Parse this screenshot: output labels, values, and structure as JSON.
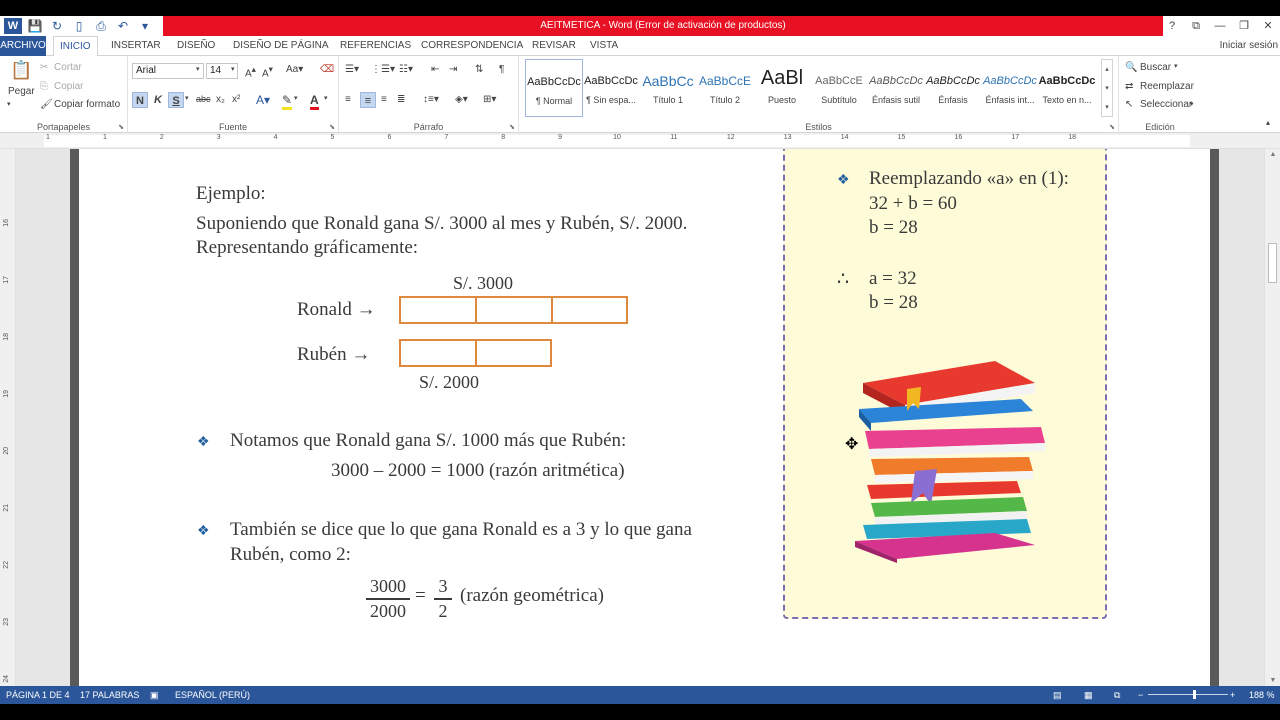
{
  "window": {
    "title": "AEITMETICA -  Word (Error de activación de productos)",
    "controls": [
      "?",
      "⧉",
      "—",
      "❐",
      "✕"
    ]
  },
  "tabs": {
    "file": "ARCHIVO",
    "items": [
      "INICIO",
      "INSERTAR",
      "DISEÑO",
      "DISEÑO DE PÁGINA",
      "REFERENCIAS",
      "CORRESPONDENCIA",
      "REVISAR",
      "VISTA"
    ],
    "signin": "Iniciar sesión"
  },
  "ribbon": {
    "clipboard": {
      "paste": "Pegar",
      "cut": "Cortar",
      "copy": "Copiar",
      "format_painter": "Copiar formato",
      "label": "Portapapeles"
    },
    "font": {
      "name": "Arial",
      "size": "14",
      "label": "Fuente"
    },
    "paragraph": {
      "label": "Párrafo"
    },
    "styles": {
      "label": "Estilos",
      "items": [
        {
          "preview": "AaBbCcDc",
          "name": "¶ Normal"
        },
        {
          "preview": "AaBbCcDc",
          "name": "¶ Sin espa..."
        },
        {
          "preview": "AaBbCc",
          "name": "Título 1"
        },
        {
          "preview": "AaBbCcE",
          "name": "Título 2"
        },
        {
          "preview": "AaBl",
          "name": "Puesto"
        },
        {
          "preview": "AaBbCcE",
          "name": "Subtítulo"
        },
        {
          "preview": "AaBbCcDc",
          "name": "Énfasis sutil"
        },
        {
          "preview": "AaBbCcDc",
          "name": "Énfasis"
        },
        {
          "preview": "AaBbCcDc",
          "name": "Énfasis int..."
        },
        {
          "preview": "AaBbCcDc",
          "name": "Texto en n..."
        }
      ]
    },
    "editing": {
      "find": "Buscar",
      "replace": "Reemplazar",
      "select": "Seleccionar",
      "label": "Edición"
    }
  },
  "ruler": {
    "numbers": [
      "1",
      "1",
      "2",
      "3",
      "4",
      "5",
      "6",
      "7",
      "8",
      "9",
      "10",
      "11",
      "12",
      "13",
      "14",
      "15",
      "16",
      "17",
      "18"
    ],
    "vertical_numbers": [
      "16",
      "17",
      "18",
      "19",
      "20",
      "21",
      "22",
      "23",
      "24"
    ]
  },
  "document": {
    "example_heading": "Ejemplo:",
    "example_line1": "Suponiendo que Ronald gana S/. 3000 al mes y Rubén, S/. 2000.",
    "example_line2": "Representando gráficamente:",
    "diagram": {
      "top_amount": "S/. 3000",
      "ronald_label": "Ronald →",
      "ruben_label": "Rubén →",
      "bottom_amount": "S/. 2000",
      "ronald_segments": 3,
      "ruben_segments": 2
    },
    "bullet1": "Notamos que Ronald gana S/. 1000 más que Rubén:",
    "bullet1_formula": "3000 – 2000 = 1000 (razón aritmética)",
    "bullet2_line1": "También se dice que lo que gana Ronald es a 3 y lo que gana",
    "bullet2_line2": "Rubén, como 2:",
    "fraction": {
      "num1": "3000",
      "den1": "2000",
      "eq": "=",
      "num2": "3",
      "den2": "2",
      "label": "(razón geométrica)"
    },
    "sidebox": {
      "bullet": "Reemplazando «a» en (1):",
      "line1": "32 + b = 60",
      "line2": "b = 28",
      "therefore": "∴",
      "result1": "a = 32",
      "result2": "b = 28"
    }
  },
  "status": {
    "page": "PÁGINA 1 DE 4",
    "words": "17 PALABRAS",
    "language": "ESPAÑOL (PERÚ)",
    "zoom": "188 %"
  }
}
